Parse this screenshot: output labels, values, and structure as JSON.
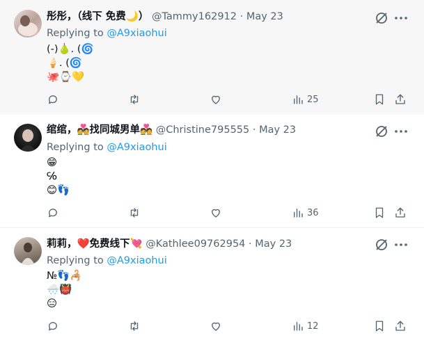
{
  "reply_prefix": "Replying to",
  "tweets": [
    {
      "name": "彤彤，（线下 免费🌙）",
      "handle": "@Tammy162912",
      "separator": "·",
      "date": "May 23",
      "replying_to": "@A9xiaohui",
      "lines": [
        "(-)🍐. (🌀",
        "🍦. (🌀",
        "🐙⌚💛"
      ],
      "views": "25"
    },
    {
      "name": "绾绾，💑找同城男单💑",
      "handle": "@Christine795555",
      "separator": "·",
      "date": "May 23",
      "replying_to": "@A9xiaohui",
      "lines": [
        "😁",
        "℅",
        "😊👣"
      ],
      "views": "36"
    },
    {
      "name": "莉莉，❤️免费线下💘",
      "handle": "@Kathlee09762954",
      "separator": "·",
      "date": "May 23",
      "replying_to": "@A9xiaohui",
      "lines": [
        "№👣🦂",
        "🌨️👹",
        "😑"
      ],
      "views": "12"
    }
  ],
  "icons": {
    "grok": "grok-icon",
    "more": "more-icon",
    "reply": "reply-icon",
    "retweet": "retweet-icon",
    "like": "like-icon",
    "views": "views-icon",
    "bookmark": "bookmark-icon",
    "share": "share-icon"
  },
  "colors": {
    "link": "#1d9bf0",
    "secondary": "#536471",
    "hover_bg": "#f7f7f7"
  }
}
